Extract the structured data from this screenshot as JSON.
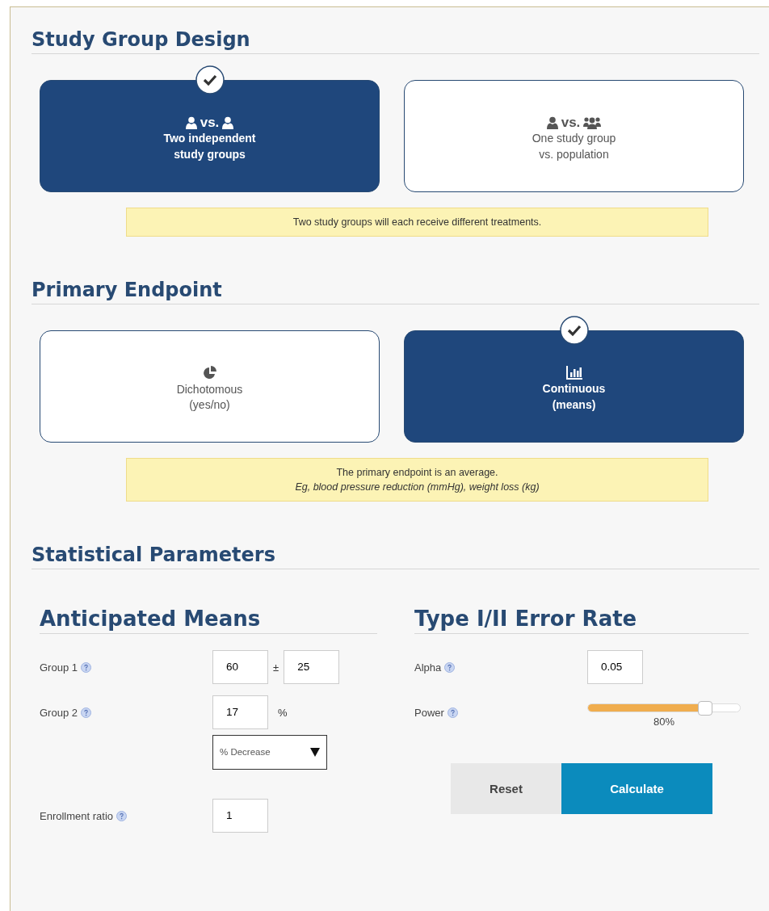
{
  "sections": [
    {
      "title": "Study Group Design",
      "options": [
        {
          "kind": "pair",
          "vs": "vs.",
          "lines": [
            "Two independent",
            "study groups"
          ],
          "selected": true
        },
        {
          "kind": "population",
          "vs": "vs.",
          "lines": [
            "One study group",
            "vs. population"
          ],
          "selected": false
        }
      ],
      "note": [
        {
          "text": "Two study groups will each receive different treatments.",
          "italic": false
        }
      ]
    },
    {
      "title": "Primary Endpoint",
      "options": [
        {
          "kind": "dichotomous",
          "lines": [
            "Dichotomous",
            "(yes/no)"
          ],
          "selected": false
        },
        {
          "kind": "continuous",
          "lines": [
            "Continuous",
            "(means)"
          ],
          "selected": true
        }
      ],
      "note": [
        {
          "text": "The primary endpoint is an average.",
          "italic": false
        },
        {
          "text": "Eg, blood pressure reduction (mmHg), weight loss (kg)",
          "italic": true
        }
      ]
    }
  ],
  "parameters": {
    "title": "Statistical Parameters",
    "means": {
      "title": "Anticipated Means",
      "rows": [
        {
          "kind": "pair",
          "label": "Group 1",
          "value": "60",
          "separator": "±",
          "value2": "25"
        },
        {
          "kind": "percent",
          "label": "Group 2",
          "value": "17",
          "unit": "%",
          "select": "% Decrease"
        },
        {
          "kind": "single",
          "label": "Enrollment ratio",
          "value": "1"
        }
      ]
    },
    "errors": {
      "title": "Type I/II Error Rate",
      "rows": [
        {
          "kind": "single",
          "label": "Alpha",
          "value": "0.05"
        },
        {
          "kind": "slider",
          "label": "Power",
          "level": 0.8,
          "reading": "80%"
        }
      ]
    },
    "buttons": [
      {
        "kind": "secondary",
        "label": "Reset"
      },
      {
        "kind": "primary",
        "label": "Calculate"
      }
    ]
  }
}
